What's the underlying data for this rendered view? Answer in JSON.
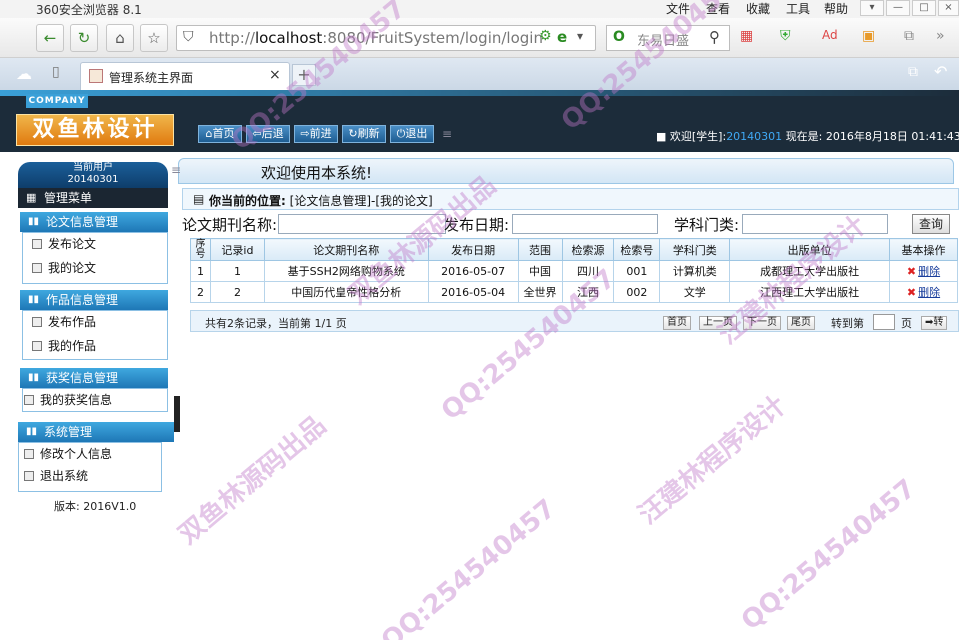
{
  "browser": {
    "app_title": "360安全浏览器 8.1",
    "menus": [
      "文件",
      "查看",
      "收藏",
      "工具",
      "帮助"
    ],
    "url_prefix": "http://",
    "url_host": "localhost",
    "url_rest": ":8080/FruitSystem/login/login",
    "search_text": "东易日盛",
    "tab_title": "管理系统主界面"
  },
  "header": {
    "company_tag": "COMPANY",
    "brand": "双鱼林设计",
    "buttons": [
      "首页",
      "后退",
      "前进",
      "刷新",
      "退出"
    ],
    "welcome_prefix": "■ 欢迎[学生]:",
    "welcome_user": "20140301",
    "welcome_suffix": "现在是: 2016年8月18日 01:41:43"
  },
  "sidebar": {
    "user_label": "当前用户",
    "user_id": "20140301",
    "main_menu": "管理菜单",
    "sections": [
      {
        "title": "论文信息管理",
        "items": [
          "发布论文",
          "我的论文"
        ]
      },
      {
        "title": "作品信息管理",
        "items": [
          "发布作品",
          "我的作品"
        ]
      },
      {
        "title": "获奖信息管理",
        "items": [
          "我的获奖信息"
        ]
      },
      {
        "title": "系统管理",
        "items": [
          "修改个人信息",
          "退出系统"
        ]
      }
    ],
    "version": "版本: 2016V1.0"
  },
  "content": {
    "welcome": "欢迎使用本系统!",
    "position_label": "你当前的位置:",
    "position_path": "[论文信息管理]-[我的论文]",
    "filters": {
      "journal_label": "论文期刊名称:",
      "date_label": "发布日期:",
      "subject_label": "学科门类:",
      "query_button": "查询"
    },
    "table": {
      "headers": [
        "序号",
        "记录id",
        "论文期刊名称",
        "发布日期",
        "范围",
        "检索源",
        "检索号",
        "学科门类",
        "出版单位",
        "基本操作"
      ],
      "rows": [
        [
          "1",
          "1",
          "基于SSH2网络购物系统",
          "2016-05-07",
          "中国",
          "四川",
          "001",
          "计算机类",
          "成都理工大学出版社",
          "删除"
        ],
        [
          "2",
          "2",
          "中国历代皇帝性格分析",
          "2016-05-04",
          "全世界",
          "江西",
          "002",
          "文学",
          "江西理工大学出版社",
          "删除"
        ]
      ]
    },
    "pager": {
      "summary": "共有2条记录，当前第 1/1 页",
      "buttons": [
        "首页",
        "上一页",
        "下一页",
        "尾页"
      ],
      "goto_label": "转到第",
      "page_unit": "页",
      "go_button": "转"
    }
  },
  "watermarks": [
    "QQ:254540457",
    "双鱼林源码出品",
    "汪建林程序设计"
  ]
}
